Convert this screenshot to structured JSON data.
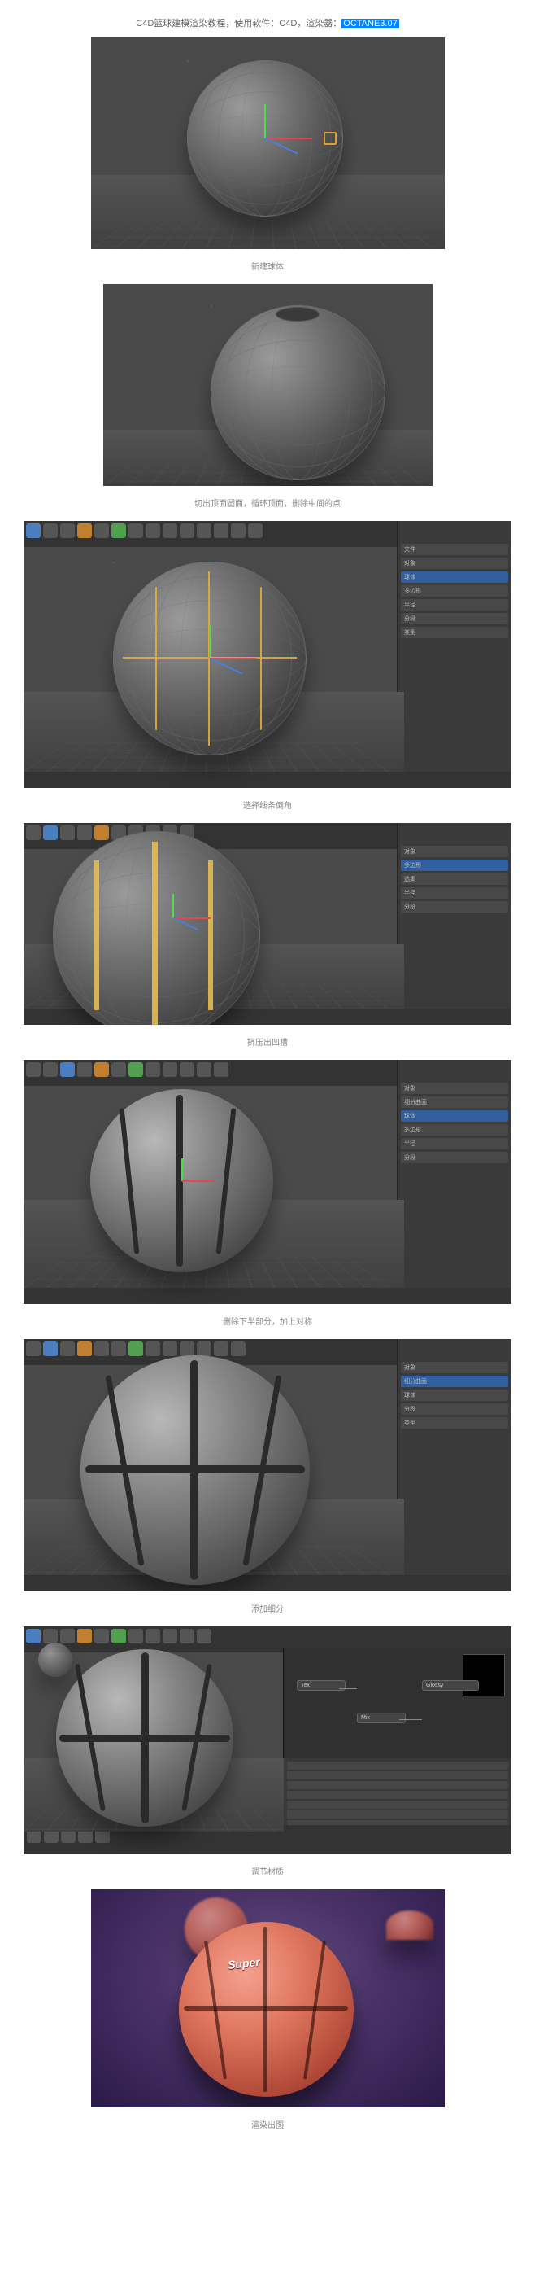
{
  "intro": {
    "prefix": "C4D篮球建模渲染教程，使用软件：C4D，渲染器：",
    "highlight": "OCTANE3.07"
  },
  "steps": [
    {
      "caption": "新建球体"
    },
    {
      "caption": "切出顶面圆面，循环顶面，删除中间的点"
    },
    {
      "caption": "选择线条倒角"
    },
    {
      "caption": "挤压出凹槽"
    },
    {
      "caption": "删除下半部分，加上对称"
    },
    {
      "caption": "添加细分"
    },
    {
      "caption": "调节材质"
    },
    {
      "caption": "渲染出图"
    }
  ],
  "panel": {
    "items": [
      "文件",
      "对象",
      "球体",
      "多边形",
      "细分曲面",
      "选集",
      "半径",
      "分段",
      "类型"
    ],
    "selected": "球体"
  },
  "render": {
    "logo": "Super"
  }
}
